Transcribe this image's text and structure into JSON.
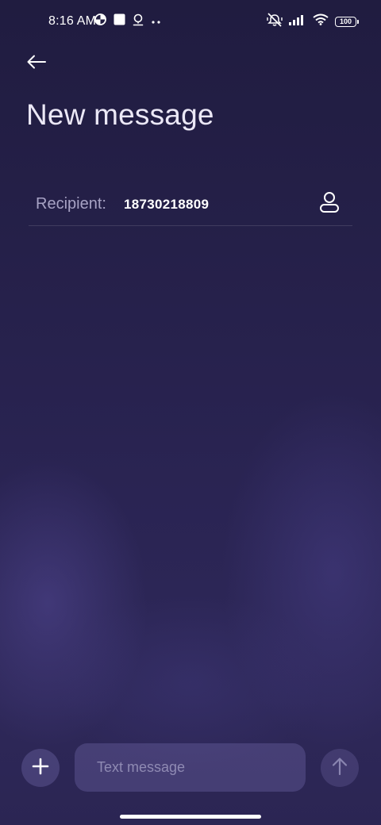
{
  "status_bar": {
    "time": "8:16 AM",
    "battery_level": "100",
    "left_icons": [
      "data-saver-icon",
      "square-notification-icon",
      "location-pin-icon",
      "more-dots-icon"
    ],
    "right_icons": [
      "mute-vibrate-icon",
      "signal-icon",
      "wifi-icon",
      "battery-icon"
    ]
  },
  "header": {
    "back_icon": "arrow-left-icon",
    "title": "New message"
  },
  "recipient": {
    "label": "Recipient:",
    "value": "18730218809",
    "contact_icon": "person-icon"
  },
  "composer": {
    "attach_icon": "plus-icon",
    "placeholder": "Text message",
    "value": "",
    "send_icon": "arrow-up-icon"
  },
  "colors": {
    "background_top": "#201c40",
    "background_bottom": "#2e2859",
    "accent_text": "#ffffff",
    "muted_text": "#a7a2c4"
  }
}
